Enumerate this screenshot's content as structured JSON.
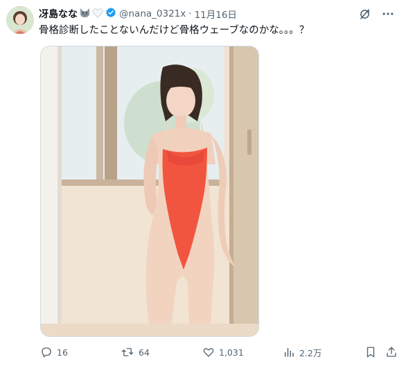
{
  "author": {
    "display_name": "冴島なな",
    "name_emojis": [
      "wolf-emoji",
      "white-heart-emoji"
    ],
    "verified": true,
    "handle": "@nana_0321x",
    "separator": "·",
    "timestamp": "11月16日"
  },
  "tweet": {
    "text": "骨格診断したことないんだけど骨格ウェーブなのかな。。。？"
  },
  "actions": {
    "replies": "16",
    "reposts": "64",
    "likes": "1,031",
    "views": "2.2万"
  },
  "icons": {
    "top": [
      "grok-icon",
      "more-icon"
    ],
    "bar": [
      "reply-icon",
      "repost-icon",
      "like-icon",
      "views-icon",
      "bookmark-icon",
      "share-icon"
    ]
  },
  "colors": {
    "text_primary": "#0f1419",
    "text_secondary": "#536471",
    "verified_blue": "#1d9bf0",
    "swimsuit": "#f2553f"
  }
}
